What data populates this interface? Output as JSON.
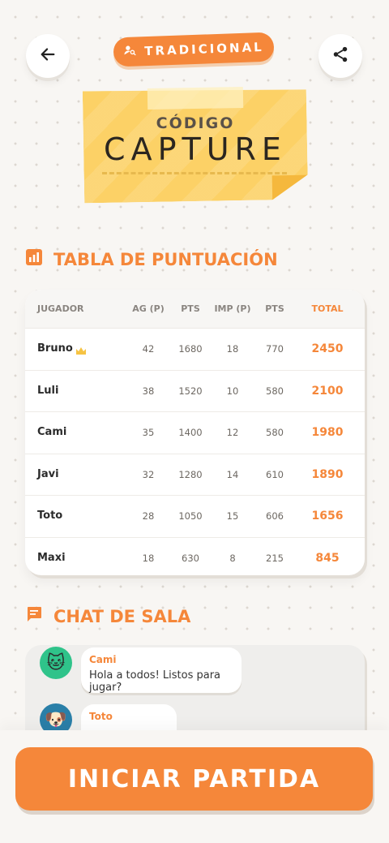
{
  "header": {
    "mode_label": "TRADICIONAL",
    "back_icon": "arrow-left-icon",
    "share_icon": "share-icon",
    "mode_icon": "user-search-icon"
  },
  "room": {
    "code_label": "CÓDIGO",
    "code_value": "CAPTURE"
  },
  "scoreboard": {
    "title": "TABLA DE PUNTUACIÓN",
    "icon": "bar-chart-icon",
    "columns": [
      "JUGADOR",
      "AG (P)",
      "PTS",
      "IMP (P)",
      "PTS",
      "TOTAL"
    ],
    "rows": [
      {
        "player": "Bruno",
        "leader": true,
        "ag": "42",
        "pts_ag": "1680",
        "imp": "18",
        "pts_imp": "770",
        "total": "2450"
      },
      {
        "player": "Luli",
        "leader": false,
        "ag": "38",
        "pts_ag": "1520",
        "imp": "10",
        "pts_imp": "580",
        "total": "2100"
      },
      {
        "player": "Cami",
        "leader": false,
        "ag": "35",
        "pts_ag": "1400",
        "imp": "12",
        "pts_imp": "580",
        "total": "1980"
      },
      {
        "player": "Javi",
        "leader": false,
        "ag": "32",
        "pts_ag": "1280",
        "imp": "14",
        "pts_imp": "610",
        "total": "1890"
      },
      {
        "player": "Toto",
        "leader": false,
        "ag": "28",
        "pts_ag": "1050",
        "imp": "15",
        "pts_imp": "606",
        "total": "1656"
      },
      {
        "player": "Maxi",
        "leader": false,
        "ag": "18",
        "pts_ag": "630",
        "imp": "8",
        "pts_imp": "215",
        "total": "845"
      }
    ]
  },
  "chat": {
    "title": "CHAT DE SALA",
    "icon": "message-icon",
    "messages": [
      {
        "author": "Cami",
        "text": "Hola a todos! Listos para jugar?",
        "avatar": "cat-icon",
        "avatar_emoji": "🐱",
        "avatar_color": "#2fc38a"
      },
      {
        "author": "Toto",
        "text": "",
        "avatar": "dog-icon",
        "avatar_emoji": "🐶",
        "avatar_color": "#2a7fa8"
      }
    ]
  },
  "actions": {
    "start_label": "INICIAR PARTIDA"
  },
  "colors": {
    "accent": "#f5873a",
    "card_yellow": "#fcd166",
    "background": "#f8f6f3"
  }
}
